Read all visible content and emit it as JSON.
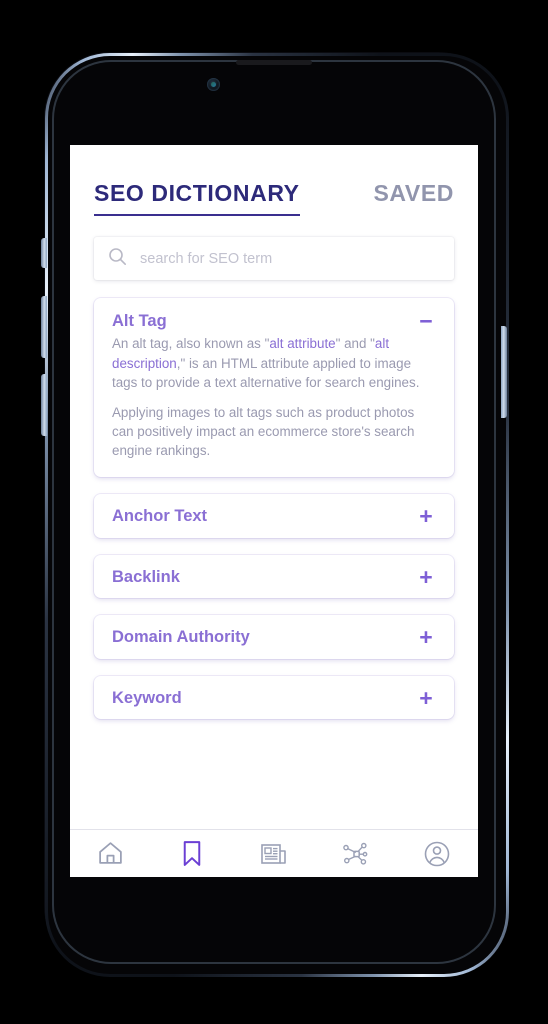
{
  "app": {
    "header": {
      "title": "SEO DICTIONARY",
      "saved_tab": "SAVED"
    },
    "search": {
      "placeholder": "search for SEO term",
      "value": "",
      "icon": "search-icon"
    },
    "entries": [
      {
        "term": "Alt Tag",
        "expanded": true,
        "toggle": "−",
        "toggle_name": "minus-icon",
        "paragraphs": [
          {
            "segments": [
              {
                "text": "An alt tag, also known as \"",
                "highlight": false
              },
              {
                "text": "alt attribute",
                "highlight": true
              },
              {
                "text": "\" and \"",
                "highlight": false
              },
              {
                "text": "alt description",
                "highlight": true
              },
              {
                "text": ",\" is an HTML attribute applied to image tags to provide a text alternative for search engines.",
                "highlight": false
              }
            ]
          },
          {
            "segments": [
              {
                "text": "Applying images to alt tags such as product photos can positively impact an ecommerce store's search engine rankings.",
                "highlight": false
              }
            ]
          }
        ]
      },
      {
        "term": "Anchor Text",
        "expanded": false,
        "toggle": "+",
        "toggle_name": "plus-icon",
        "paragraphs": []
      },
      {
        "term": "Backlink",
        "expanded": false,
        "toggle": "+",
        "toggle_name": "plus-icon",
        "paragraphs": []
      },
      {
        "term": "Domain Authority",
        "expanded": false,
        "toggle": "+",
        "toggle_name": "plus-icon",
        "paragraphs": []
      },
      {
        "term": "Keyword",
        "expanded": false,
        "toggle": "+",
        "toggle_name": "plus-icon",
        "paragraphs": []
      }
    ],
    "bottom_nav": [
      {
        "icon": "home-icon",
        "active": false
      },
      {
        "icon": "bookmark-icon",
        "active": true
      },
      {
        "icon": "news-icon",
        "active": false
      },
      {
        "icon": "network-icon",
        "active": false
      },
      {
        "icon": "profile-icon",
        "active": false
      }
    ]
  },
  "device": {
    "hardware": [
      {
        "name": "mute-switch"
      },
      {
        "name": "volume-up-button"
      },
      {
        "name": "volume-down-button"
      },
      {
        "name": "power-button"
      }
    ]
  },
  "colors": {
    "title_navy": "#2d2a7a",
    "saved_gray": "#9195ad",
    "accent_purple": "#8a6fd4",
    "toggle_purple": "#7e5fd6",
    "body_gray": "#9a9ab0",
    "placeholder_gray": "#c2c2cf",
    "nav_inactive": "#9aa0b5",
    "nav_active": "#6b3fd4",
    "screen_bg": "#ffffff",
    "device_black": "#050507"
  }
}
